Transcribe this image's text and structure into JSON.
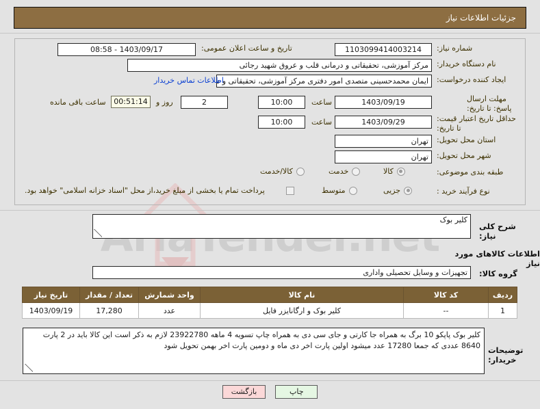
{
  "header": {
    "title": "جزئیات اطلاعات نیاز",
    "bar_color": "#8d6e42"
  },
  "watermark": {
    "text": "AriaTender.net"
  },
  "fields": {
    "need_number": {
      "label": "شماره نیاز:",
      "value": "1103099414003214"
    },
    "public_announce": {
      "label": "تاریخ و ساعت اعلان عمومی:",
      "value": "1403/09/17 - 08:58"
    },
    "buyer_org": {
      "label": "نام دستگاه خریدار:",
      "value": "مرکز آموزشی، تحقیقاتی و درمانی قلب و عروق شهید رجائی"
    },
    "requester": {
      "label": "ایجاد کننده درخواست:",
      "value": "ایمان محمدحسینی متصدی امور دفتری مرکز آموزشی، تحقیقاتی و درمانی قلب",
      "contact_link": "اطلاعات تماس خریدار"
    },
    "response_deadline": {
      "label": "مهلت ارسال پاسخ: تا تاریخ:",
      "date": "1403/09/19",
      "time_label": "ساعت",
      "time": "10:00",
      "days": "2",
      "days_label": "روز و",
      "countdown": "00:51:14",
      "countdown_label": "ساعت باقی مانده"
    },
    "price_validity": {
      "label": "حداقل تاریخ اعتبار قیمت: تا تاریخ:",
      "date": "1403/09/29",
      "time_label": "ساعت",
      "time": "10:00"
    },
    "province": {
      "label": "استان محل تحویل:",
      "value": "تهران"
    },
    "city": {
      "label": "شهر محل تحویل:",
      "value": "تهران"
    },
    "category": {
      "label": "طبقه بندی موضوعی:",
      "options": [
        "کالا",
        "خدمت",
        "کالا/خدمت"
      ],
      "selected": "کالا"
    },
    "process_type": {
      "label": "نوع فرآیند خرید :",
      "options": [
        "جزیی",
        "متوسط"
      ],
      "selected": "جزیی",
      "checkbox_label": "پرداخت تمام یا بخشی از مبلغ خرید،از محل \"اسناد خزانه اسلامی\" خواهد بود.",
      "checkbox_checked": false
    },
    "need_summary": {
      "label": "شرح کلی نیاز:",
      "value": "کلیر بوک"
    },
    "goods_section_title": "اطلاعات کالاهای مورد نیاز",
    "goods_group": {
      "label": "گروه کالا:",
      "value": "تجهیزات و وسایل تحصیلی واداری"
    }
  },
  "items_table": {
    "columns": [
      "ردیف",
      "کد کالا",
      "نام کالا",
      "واحد شمارش",
      "تعداد / مقدار",
      "تاریخ نیاز"
    ],
    "rows": [
      {
        "row_no": "1",
        "code": "--",
        "name": "کلیر بوک و ارگانایزر فایل",
        "unit": "عدد",
        "quantity": "17,280",
        "need_date": "1403/09/19"
      }
    ],
    "header_color": "#7b6136"
  },
  "buyer_notes": {
    "label": "توضیحات خریدار:",
    "text": "کلیر بوک پاپکو 10 برگ به همراه جا کارتی و جای سی دی به همراه چاپ تسویه 4 ماهه 23922780 لازم به ذکر است این کالا باید در 2 پارت 8640 عددی که جمعا 17280 عدد میشود اولین پارت اخر دی ماه و دومین پارت اخر بهمن تحویل شود"
  },
  "footer": {
    "print_label": "چاپ",
    "back_label": "بازگشت",
    "print_color": "#e5f7e3",
    "back_color": "#fbd8d8"
  }
}
